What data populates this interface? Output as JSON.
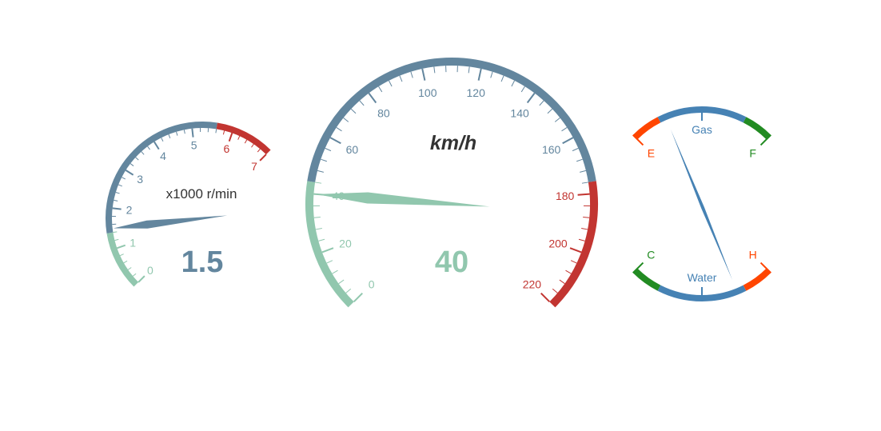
{
  "chart_data": [
    {
      "type": "gauge",
      "id": "rpm",
      "name": "x1000 r/min",
      "min": 0,
      "max": 7,
      "value": 1.5,
      "display_value": "1.5",
      "split_number": 7,
      "axis_labels": [
        "0",
        "1",
        "2",
        "3",
        "4",
        "5",
        "6",
        "7"
      ],
      "color_stops": [
        [
          0.2,
          "#91c7ae"
        ],
        [
          0.8,
          "#63869e"
        ],
        [
          1,
          "#c23531"
        ]
      ]
    },
    {
      "type": "gauge",
      "id": "speed",
      "name": "km/h",
      "min": 0,
      "max": 220,
      "value": 40,
      "display_value": "40",
      "split_number": 11,
      "axis_labels": [
        "0",
        "20",
        "40",
        "60",
        "80",
        "100",
        "120",
        "140",
        "160",
        "180",
        "200",
        "220"
      ],
      "color_stops": [
        [
          0.2,
          "#91c7ae"
        ],
        [
          0.8,
          "#63869e"
        ],
        [
          1,
          "#c23531"
        ]
      ]
    },
    {
      "type": "gauge",
      "id": "fuel",
      "name": "Gas",
      "min": 0,
      "max": 2,
      "value": 0.5,
      "end_labels": [
        "E",
        "F"
      ],
      "color_stops": [
        [
          0.2,
          "#ff4500"
        ],
        [
          0.8,
          "#4682b4"
        ],
        [
          1,
          "#228b22"
        ]
      ]
    },
    {
      "type": "gauge",
      "id": "temp",
      "name": "Water",
      "min": 0,
      "max": 2,
      "value": 0.5,
      "end_labels": [
        "C",
        "H"
      ],
      "color_stops": [
        [
          0.2,
          "#228b22"
        ],
        [
          0.8,
          "#4682b4"
        ],
        [
          1,
          "#ff4500"
        ]
      ]
    }
  ]
}
